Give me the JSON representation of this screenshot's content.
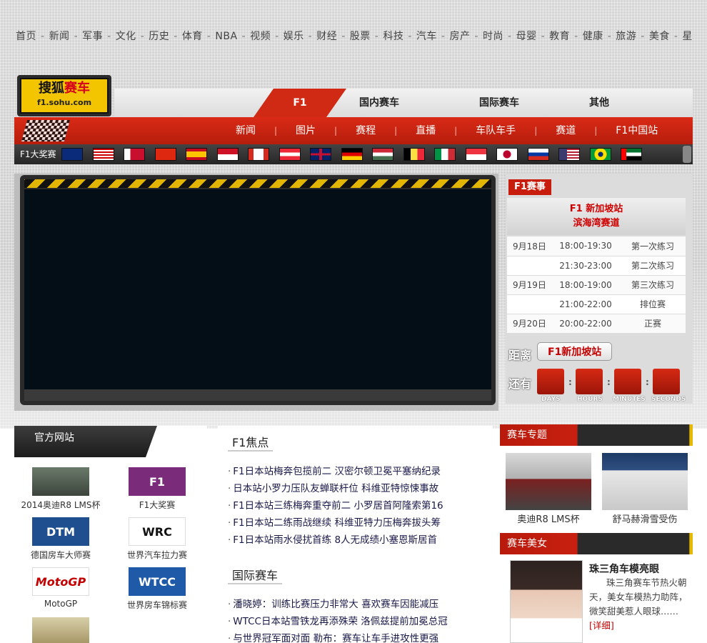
{
  "top_nav": [
    "首页",
    "新闻",
    "军事",
    "文化",
    "历史",
    "体育",
    "NBA",
    "视频",
    "娱乐",
    "财经",
    "股票",
    "科技",
    "汽车",
    "房产",
    "时尚",
    "母婴",
    "教育",
    "健康",
    "旅游",
    "美食",
    "星"
  ],
  "logo": {
    "line1_a": "搜狐",
    "line1_b": "赛车",
    "line2": "f1.sohu.com"
  },
  "tabs": [
    "F1",
    "国内赛车",
    "国际赛车",
    "其他"
  ],
  "sub_nav": [
    "新闻",
    "图片",
    "赛程",
    "直播",
    "车队车手",
    "赛道",
    "F1中国站"
  ],
  "flag_bar": {
    "label": "F1大奖赛",
    "flags": [
      "australia",
      "malaysia",
      "bahrain",
      "china",
      "spain",
      "monaco",
      "canada",
      "austria",
      "britain",
      "germany",
      "hungary",
      "belgium",
      "italy",
      "singapore",
      "japan",
      "russia",
      "usa",
      "brazil",
      "uae"
    ]
  },
  "schedule": {
    "header": "F1赛事",
    "race_line1": "F1  新加坡站",
    "race_line2": "滨海湾赛道",
    "rows": [
      {
        "date": "9月18日",
        "time": "18:00-19:30",
        "session": "第一次练习"
      },
      {
        "date": "",
        "time": "21:30-23:00",
        "session": "第二次练习"
      },
      {
        "date": "9月19日",
        "time": "18:00-19:00",
        "session": "第三次练习"
      },
      {
        "date": "",
        "time": "21:00-22:00",
        "session": "排位赛"
      },
      {
        "date": "9月20日",
        "time": "20:00-22:00",
        "session": "正赛"
      }
    ]
  },
  "countdown": {
    "distance_label": "距离",
    "destination": "F1新加坡站",
    "remaining_label": "还有",
    "units": [
      "DAYS",
      "HOURS",
      "MINUTES",
      "SECONDS"
    ]
  },
  "official": {
    "title": "官方网站",
    "items": [
      {
        "logo": "",
        "caption": "2014奥迪R8 LMS杯"
      },
      {
        "logo": "F1",
        "caption": "F1大奖赛"
      },
      {
        "logo": "DTM",
        "caption": "德国房车大师赛"
      },
      {
        "logo": "WRC",
        "caption": "世界汽车拉力赛"
      },
      {
        "logo": "MotoGP",
        "caption": "MotoGP"
      },
      {
        "logo": "WTCC",
        "caption": "世界房车锦标赛"
      },
      {
        "logo": "",
        "caption": ""
      }
    ]
  },
  "news": {
    "f1_title": "F1焦点",
    "f1_items": [
      "F1日本站梅奔包揽前二 汉密尔顿卫冕平塞纳纪录",
      "日本站小罗力压队友蝉联杆位 科维亚特惊悚事故",
      "F1日本站三练梅奔重夺前二 小罗居首阿隆索第16",
      "F1日本站二练雨战继续 科维亚特力压梅奔拔头筹",
      "F1日本站雨水侵扰首练 8人无成绩小塞恩斯居首"
    ],
    "intl_title": "国际赛车",
    "intl_items": [
      "潘晓婷：训练比赛压力非常大 喜欢赛车因能减压",
      "WTCC日本站雪铁龙再添殊荣 洛佩兹提前加冕总冠",
      "与世界冠军面对面 勒布：赛车让车手进攻性更强"
    ]
  },
  "topic": {
    "title": "赛车专题",
    "items": [
      {
        "caption": "奥迪R8 LMS杯"
      },
      {
        "caption": "舒马赫滑雪受伤"
      }
    ]
  },
  "beauty": {
    "title": "赛车美女",
    "headline": "珠三角车模亮眼",
    "text": "珠三角赛车节热火朝天，美女车模热力助阵，微笑甜美惹人眼球……",
    "more": "[详细]"
  }
}
